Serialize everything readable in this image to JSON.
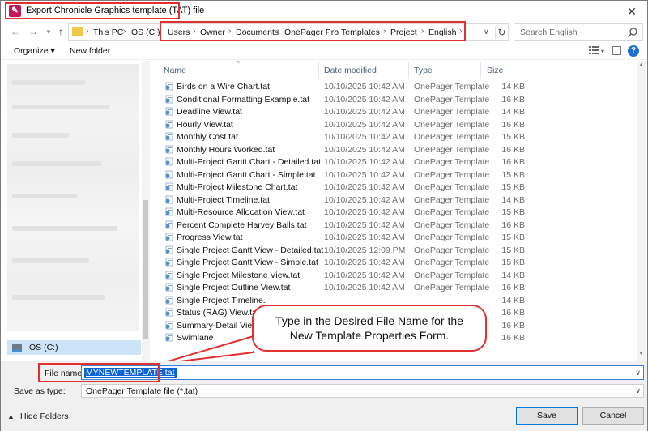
{
  "window": {
    "title": "Export Chronicle Graphics template (TAT) file",
    "close_symbol": "✕",
    "accent_color": "#e03030"
  },
  "address": {
    "crumbs_before": [
      "This PC",
      "OS (C:)"
    ],
    "crumbs_highlighted": [
      "Users",
      "Owner",
      "Documents",
      "OnePager Pro",
      "Templates",
      "Project",
      "English"
    ],
    "search_placeholder": "Search English"
  },
  "toolbar": {
    "organize_label": "Organize ▾",
    "new_folder_label": "New folder",
    "help_label": "?"
  },
  "navpane": {
    "selected_drive_label": "OS (C:)"
  },
  "columns": {
    "name": "Name",
    "date": "Date modified",
    "type": "Type",
    "size": "Size"
  },
  "files": [
    {
      "name": "Birds on a Wire Chart.tat",
      "date": "10/10/2025 10:42 AM",
      "type": "OnePager Template",
      "size": "14 KB"
    },
    {
      "name": "Conditional Formatting Example.tat",
      "date": "10/10/2025 10:42 AM",
      "type": "OnePager Template",
      "size": "16 KB"
    },
    {
      "name": "Deadline View.tat",
      "date": "10/10/2025 10:42 AM",
      "type": "OnePager Template",
      "size": "14 KB"
    },
    {
      "name": "Hourly View.tat",
      "date": "10/10/2025 10:42 AM",
      "type": "OnePager Template",
      "size": "16 KB"
    },
    {
      "name": "Monthly Cost.tat",
      "date": "10/10/2025 10:42 AM",
      "type": "OnePager Template",
      "size": "15 KB"
    },
    {
      "name": "Monthly Hours Worked.tat",
      "date": "10/10/2025 10:42 AM",
      "type": "OnePager Template",
      "size": "16 KB"
    },
    {
      "name": "Multi-Project Gantt Chart - Detailed.tat",
      "date": "10/10/2025 10:42 AM",
      "type": "OnePager Template",
      "size": "16 KB"
    },
    {
      "name": "Multi-Project Gantt Chart - Simple.tat",
      "date": "10/10/2025 10:42 AM",
      "type": "OnePager Template",
      "size": "15 KB"
    },
    {
      "name": "Multi-Project Milestone Chart.tat",
      "date": "10/10/2025 10:42 AM",
      "type": "OnePager Template",
      "size": "15 KB"
    },
    {
      "name": "Multi-Project Timeline.tat",
      "date": "10/10/2025 10:42 AM",
      "type": "OnePager Template",
      "size": "14 KB"
    },
    {
      "name": "Multi-Resource Allocation View.tat",
      "date": "10/10/2025 10:42 AM",
      "type": "OnePager Template",
      "size": "15 KB"
    },
    {
      "name": "Percent Complete Harvey Balls.tat",
      "date": "10/10/2025 10:42 AM",
      "type": "OnePager Template",
      "size": "16 KB"
    },
    {
      "name": "Progress View.tat",
      "date": "10/10/2025 10:42 AM",
      "type": "OnePager Template",
      "size": "15 KB"
    },
    {
      "name": "Single Project Gantt View - Detailed.tat",
      "date": "10/10/2025 12:09 PM",
      "type": "OnePager Template",
      "size": "15 KB"
    },
    {
      "name": "Single Project Gantt View - Simple.tat",
      "date": "10/10/2025 10:42 AM",
      "type": "OnePager Template",
      "size": "15 KB"
    },
    {
      "name": "Single Project Milestone View.tat",
      "date": "10/10/2025 10:42 AM",
      "type": "OnePager Template",
      "size": "14 KB"
    },
    {
      "name": "Single Project Outline View.tat",
      "date": "10/10/2025 10:42 AM",
      "type": "OnePager Template",
      "size": "16 KB"
    },
    {
      "name": "Single Project Timeline.",
      "date": "",
      "type": "",
      "size": "14 KB"
    },
    {
      "name": "Status (RAG) View.tat",
      "date": "",
      "type": "",
      "size": "16 KB"
    },
    {
      "name": "Summary-Detail View",
      "date": "",
      "type": "",
      "size": "16 KB"
    },
    {
      "name": "Swimlane",
      "date": "",
      "type": "",
      "size": "16 KB"
    }
  ],
  "callout": {
    "line1": "Type in the Desired File Name for the",
    "line2": "New Template Properties Form."
  },
  "form": {
    "file_name_label": "File name:",
    "file_name_value": "MYNEWTEMPLATE.tat",
    "save_as_label": "Save as type:",
    "save_as_value": "OnePager Template file (*.tat)",
    "hide_folders_label": "Hide Folders",
    "save_label": "Save",
    "cancel_label": "Cancel"
  }
}
